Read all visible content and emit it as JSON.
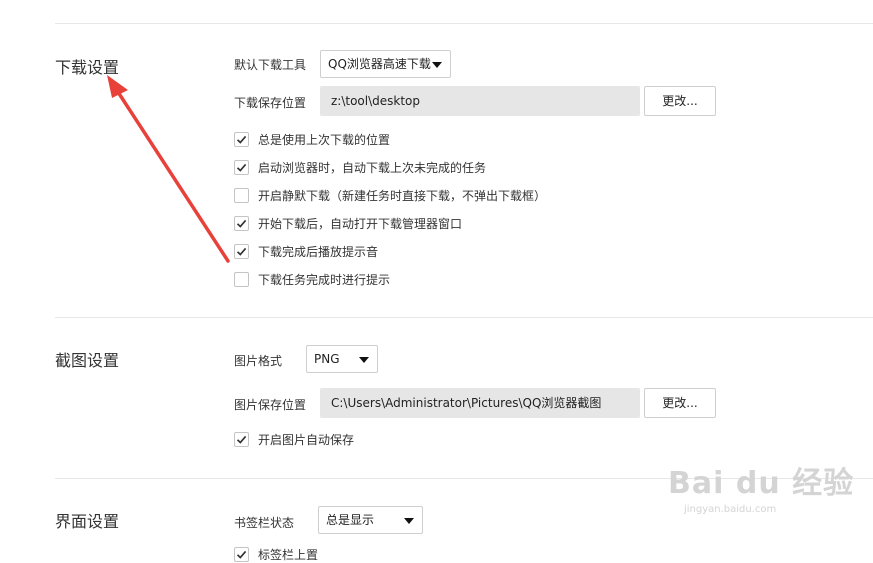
{
  "download": {
    "title": "下载设置",
    "tool_label": "默认下载工具",
    "tool_value": "QQ浏览器高速下载",
    "path_label": "下载保存位置",
    "path_value": "z:\\tool\\desktop",
    "change_label": "更改...",
    "options": [
      {
        "label": "总是使用上次下载的位置",
        "checked": true
      },
      {
        "label": "启动浏览器时，自动下载上次未完成的任务",
        "checked": true
      },
      {
        "label": "开启静默下载（新建任务时直接下载，不弹出下载框）",
        "checked": false
      },
      {
        "label": "开始下载后，自动打开下载管理器窗口",
        "checked": true
      },
      {
        "label": "下载完成后播放提示音",
        "checked": true
      },
      {
        "label": "下载任务完成时进行提示",
        "checked": false
      }
    ]
  },
  "screenshot": {
    "title": "截图设置",
    "format_label": "图片格式",
    "format_value": "PNG",
    "path_label": "图片保存位置",
    "path_value": "C:\\Users\\Administrator\\Pictures\\QQ浏览器截图",
    "change_label": "更改...",
    "autosave_label": "开启图片自动保存",
    "autosave_checked": true
  },
  "interface": {
    "title": "界面设置",
    "bookmark_label": "书签栏状态",
    "bookmark_value": "总是显示",
    "tabbar_label": "标签栏上置",
    "tabbar_checked": true
  },
  "watermark": {
    "logo": "Bai du 经验",
    "url": "jingyan.baidu.com"
  },
  "colors": {
    "annotation_arrow": "#e8413a",
    "divider": "#e7e7e7",
    "path_background": "#e6e6e6"
  }
}
